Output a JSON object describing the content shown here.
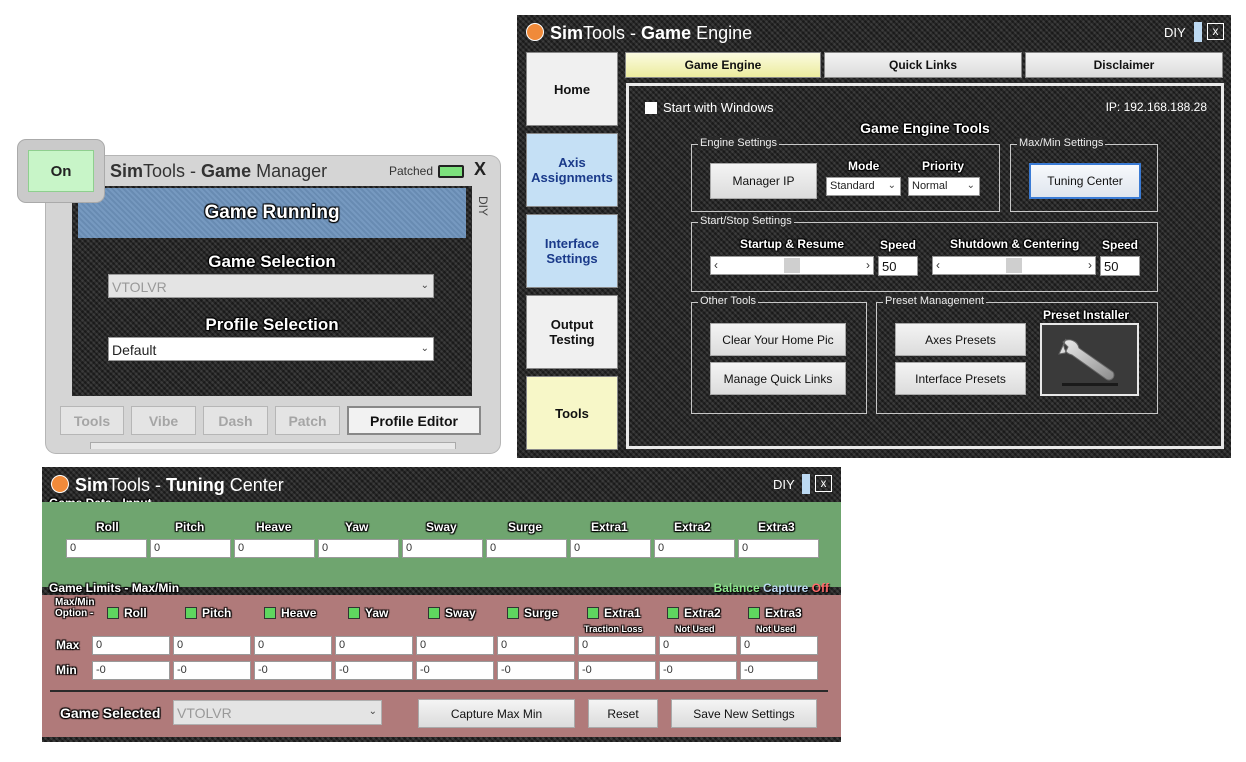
{
  "game_manager": {
    "on_label": "On",
    "title_sim": "Sim",
    "title_tools": "Tools - ",
    "title_game": "Game",
    "title_manager": " Manager",
    "patched_label": "Patched",
    "close_label": "X",
    "side_label": "DIY",
    "status": "Game Running",
    "game_selection_label": "Game Selection",
    "game_selection_value": "VTOLVR",
    "profile_selection_label": "Profile Selection",
    "profile_selection_value": "Default",
    "buttons": [
      "Tools",
      "Vibe",
      "Dash",
      "Patch"
    ],
    "profile_editor_label": "Profile Editor"
  },
  "game_engine": {
    "title_sim": "Sim",
    "title_tools": "Tools - ",
    "title_game": "Game",
    "title_engine": " Engine",
    "diy_label": "DIY",
    "close_label": "x",
    "side_tabs": [
      {
        "label": "Home"
      },
      {
        "label": "Axis Assignments"
      },
      {
        "label": "Interface Settings"
      },
      {
        "label": "Output Testing"
      },
      {
        "label": "Tools"
      }
    ],
    "top_tabs": [
      "Game Engine",
      "Quick Links",
      "Disclaimer"
    ],
    "start_with_windows": "Start with Windows",
    "ip_label": "IP: 192.168.188.28",
    "section_title": "Game Engine Tools",
    "engine_settings_legend": "Engine Settings",
    "manager_ip_button": "Manager IP",
    "mode_label": "Mode",
    "mode_value": "Standard",
    "priority_label": "Priority",
    "priority_value": "Normal",
    "maxmin_legend": "Max/Min Settings",
    "tuning_center_button": "Tuning Center",
    "startstop_legend": "Start/Stop Settings",
    "startup_label": "Startup & Resume",
    "speed_label": "Speed",
    "startup_speed": "50",
    "shutdown_label": "Shutdown & Centering",
    "shutdown_speed": "50",
    "startup_slider_position": 0.5,
    "shutdown_slider_position": 0.5,
    "other_tools_legend": "Other Tools",
    "clear_home_pic_button": "Clear Your Home Pic",
    "manage_quick_links_button": "Manage Quick Links",
    "preset_legend": "Preset Management",
    "axes_presets_button": "Axes Presets",
    "interface_presets_button": "Interface Presets",
    "preset_installer_label": "Preset Installer",
    "preset_installer_icon": "wrench-icon"
  },
  "tuning_center": {
    "title_sim": "Sim",
    "title_tools": "Tools - ",
    "title_tuning": "Tuning",
    "title_center": " Center",
    "diy_label": "DIY",
    "close_label": "x",
    "input_section": "Game Data - Input",
    "axes": [
      "Roll",
      "Pitch",
      "Heave",
      "Yaw",
      "Sway",
      "Surge",
      "Extra1",
      "Extra2",
      "Extra3"
    ],
    "input_values": [
      "0",
      "0",
      "0",
      "0",
      "0",
      "0",
      "0",
      "0",
      "0"
    ],
    "limits_section": "Game Limits - Max/Min",
    "balance_label": "Balance",
    "capture_label": "Capture",
    "off_label": "Off",
    "maxmin_option_label": "Max/Min Option -",
    "extra_notes": [
      "Traction Loss",
      "Not Used",
      "Not Used"
    ],
    "max_label": "Max",
    "min_label": "Min",
    "max_values": [
      "0",
      "0",
      "0",
      "0",
      "0",
      "0",
      "0",
      "0",
      "0"
    ],
    "min_values": [
      "-0",
      "-0",
      "-0",
      "-0",
      "-0",
      "-0",
      "-0",
      "-0",
      "-0"
    ],
    "game_selected_label": "Game Selected",
    "game_selected_value": "VTOLVR",
    "capture_button": "Capture Max Min",
    "reset_button": "Reset",
    "save_button": "Save New Settings"
  },
  "colors": {
    "green_check": "#5fd65f",
    "selected_tab_blue": "#c5e0f5",
    "tools_tab_yellow": "#f7f7c8",
    "status_blue": "#6f94bd",
    "input_green": "#6fa56f",
    "limits_pink": "#b07a7a"
  }
}
